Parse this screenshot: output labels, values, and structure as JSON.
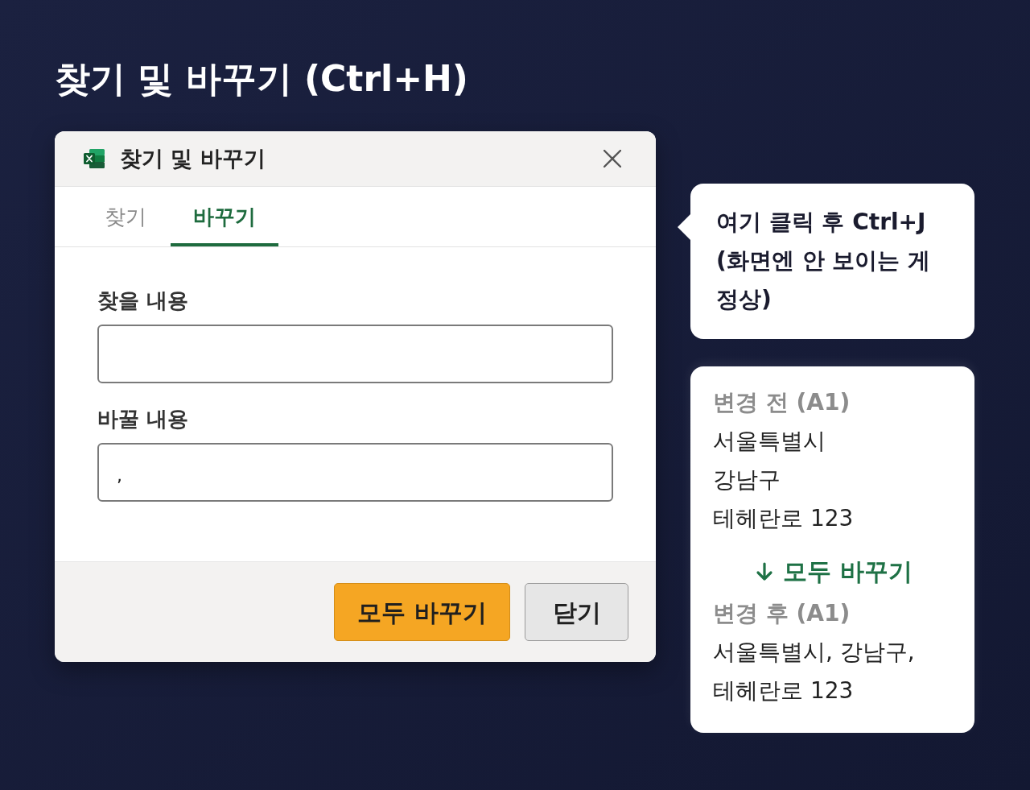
{
  "heading": "찾기 및 바꾸기 (Ctrl+H)",
  "dialog": {
    "title": "찾기 및 바꾸기",
    "tabs": [
      {
        "label": "찾기",
        "selected": false
      },
      {
        "label": "바꾸기",
        "selected": true
      }
    ],
    "fields": [
      {
        "label": "찾을 내용"
      },
      {
        "label": "바꿀 내용",
        "value": ","
      }
    ],
    "buttons": [
      {
        "label": "모두 바꾸기",
        "kind": "primary"
      },
      {
        "label": "닫기",
        "kind": "secondary"
      }
    ]
  },
  "callout": {
    "text": "여기 클릭 후 Ctrl+J (화면엔 안 보이는 게 정상)"
  },
  "example": {
    "before": {
      "label": "변경 전 (A1)",
      "lines": [
        "서울특별시",
        "강남구",
        "테헤란로 123"
      ]
    },
    "action": "모두 바꾸기",
    "after": {
      "label": "변경 후 (A1)",
      "text": "서울특별시, 강남구, 테헤란로 123"
    }
  }
}
